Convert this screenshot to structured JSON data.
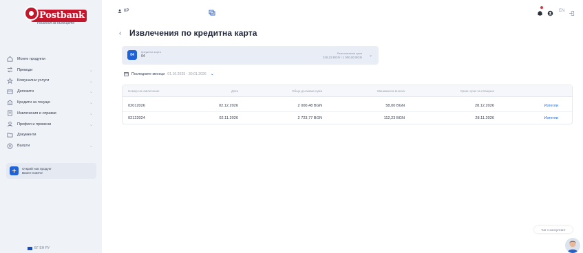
{
  "brand": {
    "logo_text": "Postbank",
    "tagline": "Решения за бъдещето"
  },
  "sidebar": {
    "items": [
      {
        "label": "Моите продукти",
        "icon": "home-icon",
        "has_chevron": false
      },
      {
        "label": "Преводи",
        "icon": "transfer-icon",
        "has_chevron": true
      },
      {
        "label": "Комунални услуги",
        "icon": "utility-icon",
        "has_chevron": true
      },
      {
        "label": "Депозити",
        "icon": "deposit-icon",
        "has_chevron": true
      },
      {
        "label": "Кредити за текущо",
        "icon": "credit-icon",
        "has_chevron": true
      },
      {
        "label": "Извлечения и справки",
        "icon": "statement-icon",
        "has_chevron": true
      },
      {
        "label": "Профил и промени",
        "icon": "profile-icon",
        "has_chevron": true
      },
      {
        "label": "Документи",
        "icon": "document-icon",
        "has_chevron": false
      },
      {
        "label": "Валути",
        "icon": "currency-icon",
        "has_chevron": true
      }
    ],
    "promo": {
      "line1": "Открий нов продукт",
      "line2": "Вижте повече"
    },
    "footer_text": "БГ ЕН РУ"
  },
  "topbar": {
    "user": "КР",
    "lang": "EN"
  },
  "page": {
    "title": "Извлечения по кредитна карта",
    "back_label": "‹"
  },
  "card_selector": {
    "label": "Кредитна карта",
    "value": "04",
    "badge": "04",
    "balance_label": "Разполагаема сума",
    "balance_value": "318,22 BGN / 1 000,00 BGN"
  },
  "period": {
    "label": "Последните месеци",
    "dates": "01.10.2025 - 30.01.2026"
  },
  "table": {
    "headers": [
      "Номер на извлечение",
      "Дата",
      "Общо дължима сума",
      "Минимална вноска",
      "Краен срок за плащане",
      ""
    ],
    "rows": [
      {
        "number": "02012026",
        "date": "02.12.2026",
        "total": "2 000,48 BGN",
        "min": "58,00 BGN",
        "due": "28.12.2026",
        "action": "Изтегли"
      },
      {
        "number": "02122024",
        "date": "02.11.2026",
        "total": "2 723,77 BGN",
        "min": "112,23 BGN",
        "due": "28.11.2026",
        "action": "Изтегли"
      }
    ]
  },
  "chat": {
    "label": "Чат с консултант"
  },
  "colors": {
    "brand_red": "#c5172c",
    "accent_blue": "#1f62d8",
    "sidebar_bg": "#eff2f7"
  }
}
